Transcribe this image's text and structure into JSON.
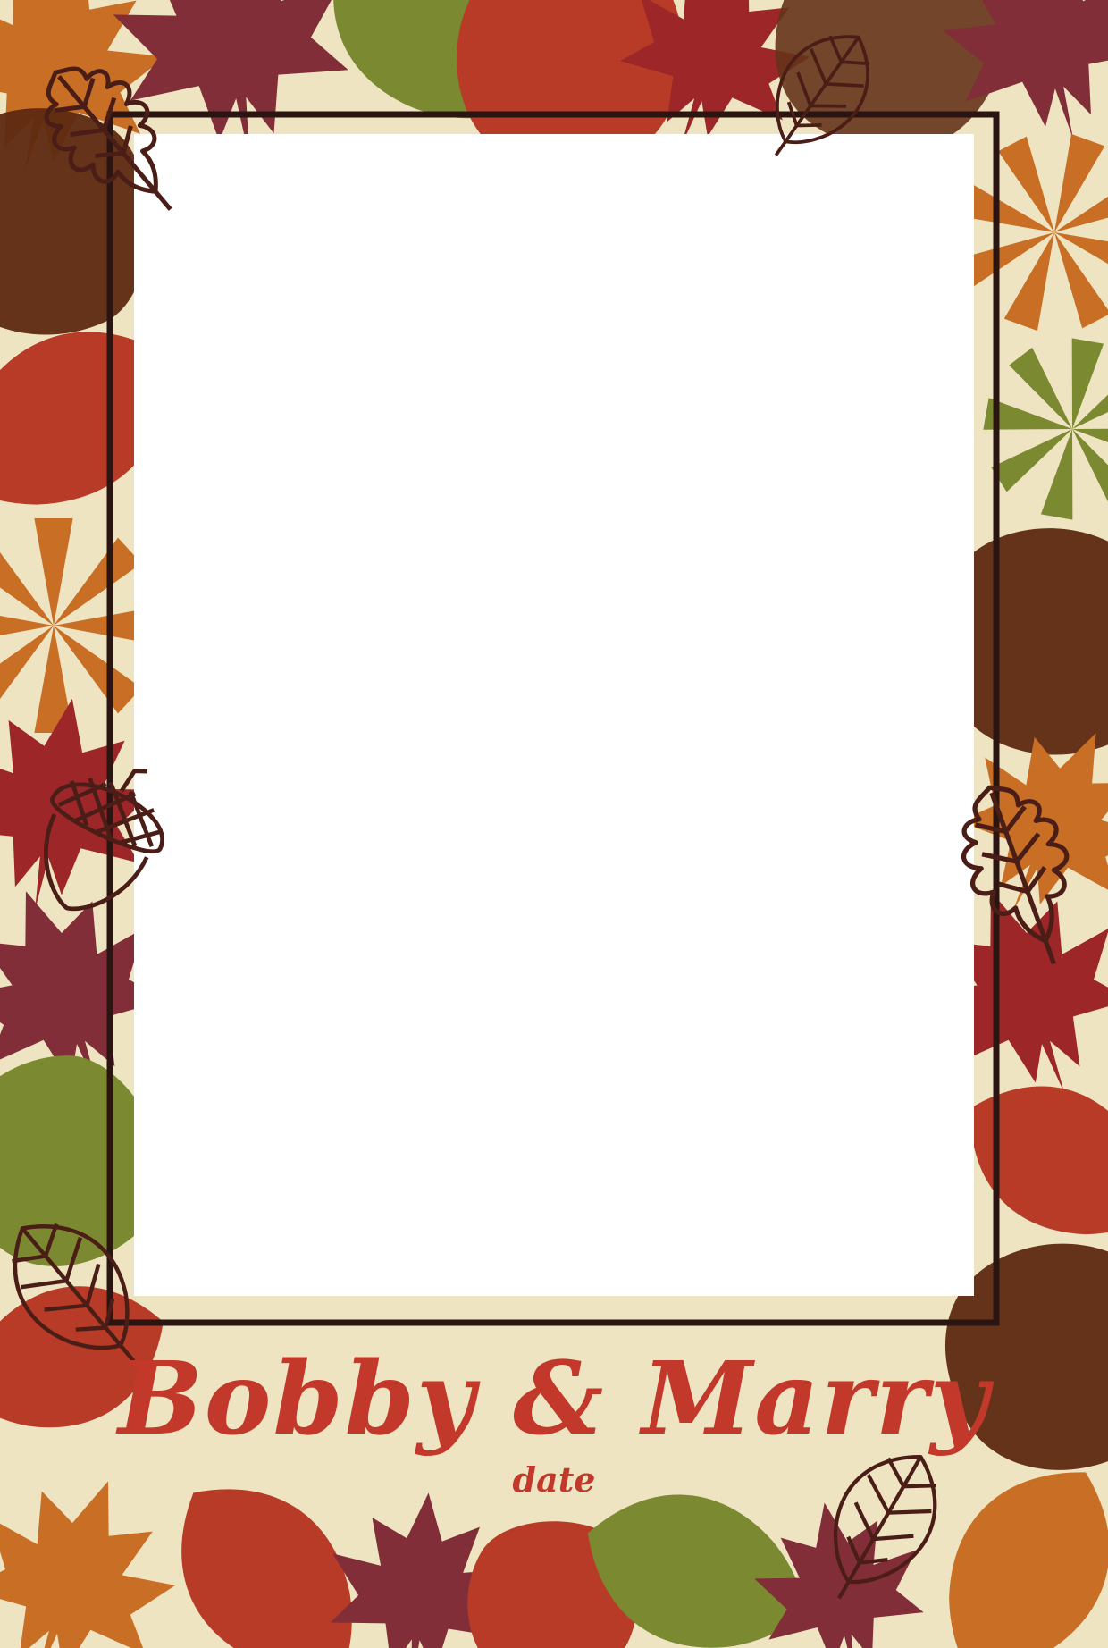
{
  "card": {
    "names": "Bobby & Marry",
    "date": "date"
  },
  "colors": {
    "background": "#efe4c2",
    "photo_area": "#ffffff",
    "frame_line": "#2b1512",
    "title_text": "#c2392b",
    "outline": "#4a1e17",
    "leaf_orange": "#c8681d",
    "leaf_plum": "#7c2531",
    "leaf_green": "#75862a",
    "leaf_red": "#b5321f",
    "leaf_crimson": "#981c20",
    "leaf_brown": "#5e2a12"
  },
  "decor": {
    "icons": [
      "maple-leaf-icon",
      "oak-leaf-icon",
      "round-leaf-icon",
      "acorn-icon",
      "chestnut-leaf-icon"
    ]
  }
}
